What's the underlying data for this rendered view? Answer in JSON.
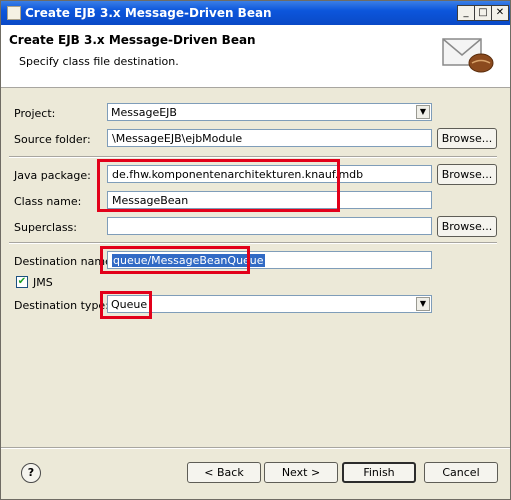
{
  "window": {
    "title": "Create EJB 3.x Message-Driven Bean",
    "minimize": "_",
    "maximize": "□",
    "close": "✕"
  },
  "header": {
    "title": "Create EJB 3.x Message-Driven Bean",
    "subtitle": "Specify class file destination.",
    "icon": "envelope-bean-icon"
  },
  "form": {
    "project": {
      "label": "Project:",
      "value": "MessageEJB"
    },
    "source_folder": {
      "label": "Source folder:",
      "value": "\\MessageEJB\\ejbModule",
      "button": "Browse..."
    },
    "java_package": {
      "label": "Java package:",
      "value": "de.fhw.komponentenarchitekturen.knauf.mdb",
      "button": "Browse..."
    },
    "class_name": {
      "label": "Class name:",
      "value": "MessageBean"
    },
    "superclass": {
      "label": "Superclass:",
      "value": "",
      "button": "Browse..."
    },
    "destination_name": {
      "label": "Destination name:",
      "value": "queue/MessageBeanQueue"
    },
    "jms": {
      "label": "JMS",
      "checked": true
    },
    "destination_type": {
      "label": "Destination type:",
      "value": "Queue"
    }
  },
  "footer": {
    "help": "?",
    "back": "< Back",
    "next": "Next >",
    "finish": "Finish",
    "cancel": "Cancel"
  },
  "highlight_color": "#e2001a"
}
